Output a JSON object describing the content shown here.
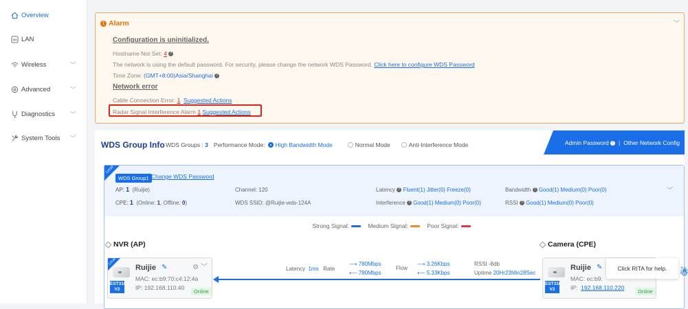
{
  "sidebar": {
    "items": [
      {
        "label": "Overview",
        "icon": "home-icon",
        "active": true,
        "chevron": false
      },
      {
        "label": "LAN",
        "icon": "lan-icon",
        "active": false,
        "chevron": false
      },
      {
        "label": "Wireless",
        "icon": "wireless-icon",
        "active": false,
        "chevron": true
      },
      {
        "label": "Advanced",
        "icon": "advanced-icon",
        "active": false,
        "chevron": true
      },
      {
        "label": "Diagnostics",
        "icon": "diagnostics-icon",
        "active": false,
        "chevron": true
      },
      {
        "label": "System Tools",
        "icon": "tools-icon",
        "active": false,
        "chevron": true
      }
    ]
  },
  "alarm": {
    "title": "Alarm",
    "heading_config": "Configuration is uninitialized.",
    "hostname_prefix": "Hostname Not Set:",
    "hostname_count": "4",
    "wds_password_text": "The network is using the default password. For security, please change the network WDS Password.",
    "wds_password_link": "Click here to configure WDS Password",
    "timezone_prefix": "Time Zone:",
    "timezone_value": "(GMT+8:00)Asia/Shanghai",
    "heading_network": "Network error",
    "cable_prefix": "Cable Connection Error:",
    "cable_count": "1",
    "cable_link": "Suggested Actions",
    "radar_prefix": "Radar Signal Interference Alarm",
    "radar_count": "1",
    "radar_link": "Suggested Actions"
  },
  "wds": {
    "title": "WDS Group Info",
    "groups_label": "WDS Groups :",
    "groups_count": "3",
    "perf_label": "Performance Mode:",
    "modes": [
      "High Bandwidth Mode",
      "Normal Mode",
      "Anti-Interference Mode"
    ],
    "selected_mode": "High Bandwidth Mode",
    "admin_password": "Admin Password",
    "other_config": "Other Network Config"
  },
  "group": {
    "local_tag": "Local",
    "name": "WDS Group1",
    "change_password": "Change WDS Password",
    "ap_label": "AP:",
    "ap_count": "1",
    "ap_name": "(Ruijie)",
    "cpe_label": "CPE:",
    "cpe_count": "1",
    "cpe_online_prefix": "(Online:",
    "cpe_online": "1",
    "cpe_offline_prefix": ", Offline:",
    "cpe_offline": "0",
    "cpe_close": ")",
    "channel": "Channel: 120",
    "ssid": "WDS SSID: @Ruijie-wds-124A",
    "latency_label": "Latency",
    "latency_value": "Fluent(1)  Jitter(0)  Freeze(0)",
    "interference_label": "Interference",
    "interference_value": "Good(1)  Medium(0)  Poor(0)",
    "bandwidth_label": "Bandwidth",
    "bandwidth_value": "Good(1)  Medium(0)  Poor(0)",
    "rssi_label": "RSSI",
    "rssi_value": "Good(1)  Medium(0)  Poor(0)"
  },
  "legend": {
    "strong": "Strong Signal:",
    "medium": "Medium Signal:",
    "poor": "Poor Signal:",
    "strong_color": "#1a6fe8",
    "medium_color": "#f08c2e",
    "poor_color": "#e8334a"
  },
  "nvr": {
    "section": "NVR (AP)",
    "local_tag": "Local",
    "name": "Ruijie",
    "mac": "MAC:  ec:b9:70:c4:12:4a",
    "ip": "IP:  192.168.110.40",
    "model": "EST310-V2",
    "status": "Online"
  },
  "link": {
    "latency_label": "Latency",
    "latency_value": "1ms",
    "rate_label": "Rate",
    "rate_up": "780Mbps",
    "rate_down": "780Mbps",
    "flow_label": "Flow",
    "flow_up": "3.26Kbps",
    "flow_down": "5.33Kbps",
    "rssi": "RSSI -8db",
    "uptime_label": "Uptime",
    "uptime_value": "20Hr23Min28Sec"
  },
  "camera": {
    "section": "Camera (CPE)",
    "name": "Ruijie",
    "mac": "MAC:  ec:b9:",
    "ip_label": "IP:",
    "ip": "192.168.110.220",
    "model": "EST310-V2",
    "status": "Online"
  },
  "help": {
    "text": "Click RITA for help."
  }
}
